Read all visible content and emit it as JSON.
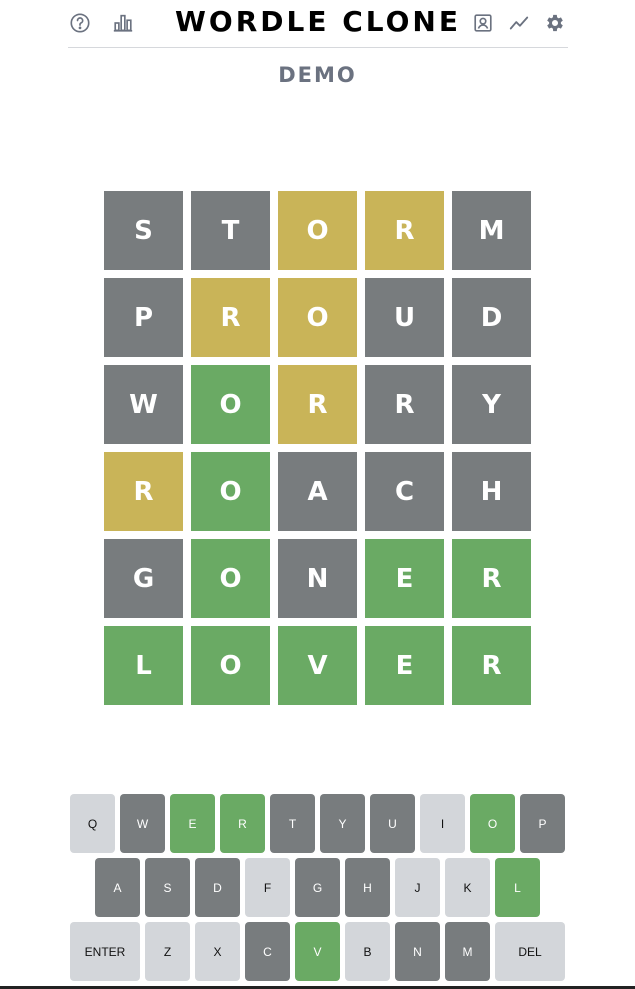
{
  "header": {
    "title": "WORDLE CLONE",
    "icons": {
      "left": [
        "help-icon",
        "stats-icon"
      ],
      "right": [
        "profile-icon",
        "trend-icon",
        "settings-icon"
      ]
    }
  },
  "mode_label": "DEMO",
  "colors": {
    "absent": "#787c7e",
    "present": "#c9b458",
    "correct": "#6aaa64",
    "unused": "#d3d6da"
  },
  "board": [
    {
      "word": "STORM",
      "letters": [
        "S",
        "T",
        "O",
        "R",
        "M"
      ],
      "states": [
        "absent",
        "absent",
        "present",
        "present",
        "absent"
      ]
    },
    {
      "word": "PROUD",
      "letters": [
        "P",
        "R",
        "O",
        "U",
        "D"
      ],
      "states": [
        "absent",
        "present",
        "present",
        "absent",
        "absent"
      ]
    },
    {
      "word": "WORRY",
      "letters": [
        "W",
        "O",
        "R",
        "R",
        "Y"
      ],
      "states": [
        "absent",
        "correct",
        "present",
        "absent",
        "absent"
      ]
    },
    {
      "word": "ROACH",
      "letters": [
        "R",
        "O",
        "A",
        "C",
        "H"
      ],
      "states": [
        "present",
        "correct",
        "absent",
        "absent",
        "absent"
      ]
    },
    {
      "word": "GONER",
      "letters": [
        "G",
        "O",
        "N",
        "E",
        "R"
      ],
      "states": [
        "absent",
        "correct",
        "absent",
        "correct",
        "correct"
      ]
    },
    {
      "word": "LOVER",
      "letters": [
        "L",
        "O",
        "V",
        "E",
        "R"
      ],
      "states": [
        "correct",
        "correct",
        "correct",
        "correct",
        "correct"
      ]
    }
  ],
  "keyboard": {
    "rows": [
      [
        {
          "label": "Q",
          "state": "unused"
        },
        {
          "label": "W",
          "state": "absent"
        },
        {
          "label": "E",
          "state": "correct"
        },
        {
          "label": "R",
          "state": "correct"
        },
        {
          "label": "T",
          "state": "absent"
        },
        {
          "label": "Y",
          "state": "absent"
        },
        {
          "label": "U",
          "state": "absent"
        },
        {
          "label": "I",
          "state": "unused"
        },
        {
          "label": "O",
          "state": "correct"
        },
        {
          "label": "P",
          "state": "absent"
        }
      ],
      [
        {
          "label": "A",
          "state": "absent"
        },
        {
          "label": "S",
          "state": "absent"
        },
        {
          "label": "D",
          "state": "absent"
        },
        {
          "label": "F",
          "state": "unused"
        },
        {
          "label": "G",
          "state": "absent"
        },
        {
          "label": "H",
          "state": "absent"
        },
        {
          "label": "J",
          "state": "unused"
        },
        {
          "label": "K",
          "state": "unused"
        },
        {
          "label": "L",
          "state": "correct"
        }
      ],
      [
        {
          "label": "ENTER",
          "state": "unused",
          "wide": true
        },
        {
          "label": "Z",
          "state": "unused"
        },
        {
          "label": "X",
          "state": "unused"
        },
        {
          "label": "C",
          "state": "absent"
        },
        {
          "label": "V",
          "state": "correct"
        },
        {
          "label": "B",
          "state": "unused"
        },
        {
          "label": "N",
          "state": "absent"
        },
        {
          "label": "M",
          "state": "absent"
        },
        {
          "label": "DEL",
          "state": "unused",
          "wide": true
        }
      ]
    ]
  }
}
